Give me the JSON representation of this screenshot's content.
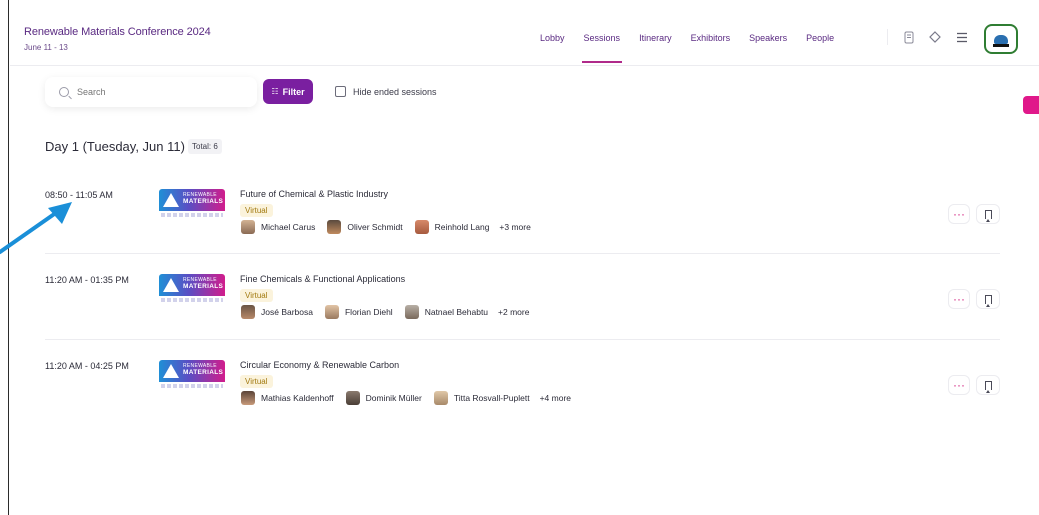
{
  "header": {
    "title": "Renewable Materials Conference 2024",
    "dates": "June 11 - 13",
    "nav": [
      "Lobby",
      "Sessions",
      "Itinerary",
      "Exhibitors",
      "Speakers",
      "People"
    ],
    "active_nav": "Sessions",
    "icons": [
      "badge-icon",
      "diamond-icon",
      "menu-icon",
      "profile-avatar-icon"
    ]
  },
  "search": {
    "placeholder": "Search"
  },
  "filter_label": "Filter",
  "hide_ended_label": "Hide ended sessions",
  "day": {
    "title": "Day 1  (Tuesday, Jun 11)",
    "total": "Total: 6"
  },
  "thumb": {
    "line1": "RENEWABLE",
    "line2": "MATERIALS"
  },
  "sessions": [
    {
      "time": "08:50 - 11:05 AM",
      "title": "Future of Chemical & Plastic Industry",
      "format": "Virtual",
      "speakers": [
        "Michael Carus",
        "Oliver Schmidt",
        "Reinhold Lang"
      ],
      "more": "+3 more"
    },
    {
      "time": "11:20 AM - 01:35 PM",
      "title": "Fine Chemicals & Functional Applications",
      "format": "Virtual",
      "speakers": [
        "José Barbosa",
        "Florian Diehl",
        "Natnael Behabtu"
      ],
      "more": "+2 more"
    },
    {
      "time": "11:20 AM - 04:25 PM",
      "title": "Circular Economy & Renewable Carbon",
      "format": "Virtual",
      "speakers": [
        "Mathias Kaldenhoff",
        "Dominik Müller",
        "Titta Rosvall-Puplett"
      ],
      "more": "+4 more"
    }
  ],
  "actions": {
    "more": "···"
  },
  "colors": {
    "accent": "#7a1fa0",
    "nav_underline": "#b02a8a",
    "brand_text": "#5a2a82",
    "virtual_text": "#a27a10",
    "virtual_bg": "#fbf3dc",
    "arrow": "#1a8fd8"
  }
}
